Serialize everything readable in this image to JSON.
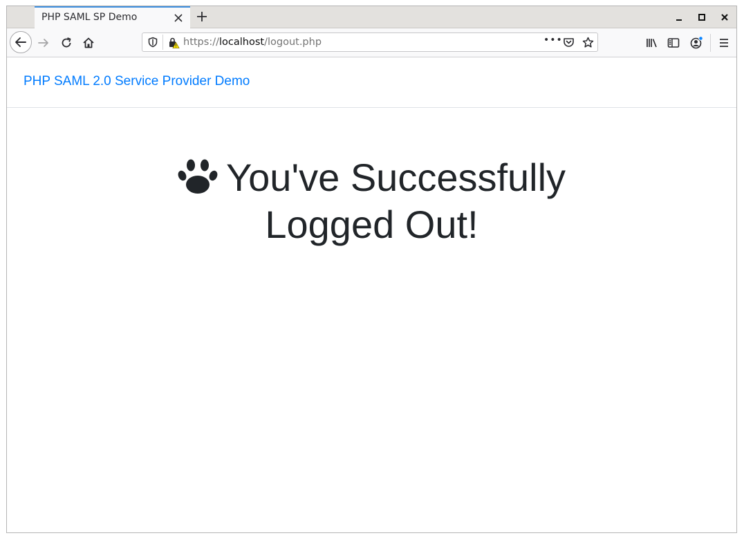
{
  "browser": {
    "tab_title": "PHP SAML SP Demo",
    "url": {
      "scheme": "https://",
      "host": "localhost",
      "path": "/logout.php"
    },
    "urlbar_more": "•••"
  },
  "page": {
    "brand": "PHP SAML 2.0 Service Provider Demo",
    "heading": "You've Successfully Logged Out!"
  },
  "colors": {
    "link": "#007bff",
    "heading": "#212529",
    "tab_accent": "#3d8fe0"
  }
}
